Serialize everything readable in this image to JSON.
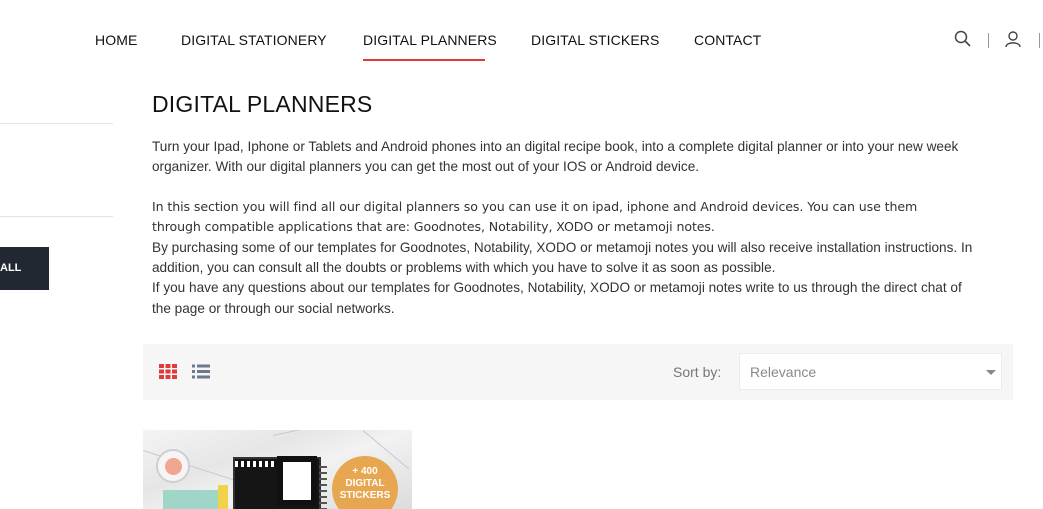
{
  "nav": {
    "items": [
      "HOME",
      "DIGITAL STATIONERY",
      "DIGITAL PLANNERS",
      "DIGITAL STICKERS",
      "CONTACT"
    ],
    "active": "DIGITAL PLANNERS",
    "icons": [
      "search-icon",
      "user-icon"
    ],
    "accent_color": "#e03a3a"
  },
  "sidebar": {
    "button_label": "ALL",
    "button_color": "#222831"
  },
  "page": {
    "title": "DIGITAL PLANNERS",
    "paragraph1_line1": "Turn your Ipad, Iphone or Tablets and Android phones into an digital recipe book, into a complete digital planner or into your new week",
    "paragraph1_line2": "organizer. With our digital planners you can get the most out of your IOS or Android device.",
    "paragraph2_line1": "In this section you will find all our digital planners so you can use it on ipad, iphone and Android devices. You can use them",
    "paragraph2_line2": "through compatible applications that are: Goodnotes, Notability, XODO or metamoji notes.",
    "paragraph3_line1": "By purchasing some of our templates for Goodnotes, Notability, XODO or metamoji notes you will also receive installation instructions. In",
    "paragraph3_line2": "addition, you can consult all the doubts or problems with which you have to solve it as soon as possible.",
    "paragraph4_line1": "If you have any questions about our templates for Goodnotes, Notability, XODO or metamoji notes write to us through the direct chat of",
    "paragraph4_line2": "the page or through our social networks."
  },
  "toolbar": {
    "view_icons": [
      "grid-view-icon",
      "list-view-icon"
    ],
    "active_view_color": "#e03a3a",
    "sort_label": "Sort by:",
    "sort_value": "Relevance"
  },
  "product": {
    "badge_line1": "+ 400",
    "badge_line2": "DIGITAL",
    "badge_line3": "STICKERS",
    "badge_color": "#e7a650"
  }
}
